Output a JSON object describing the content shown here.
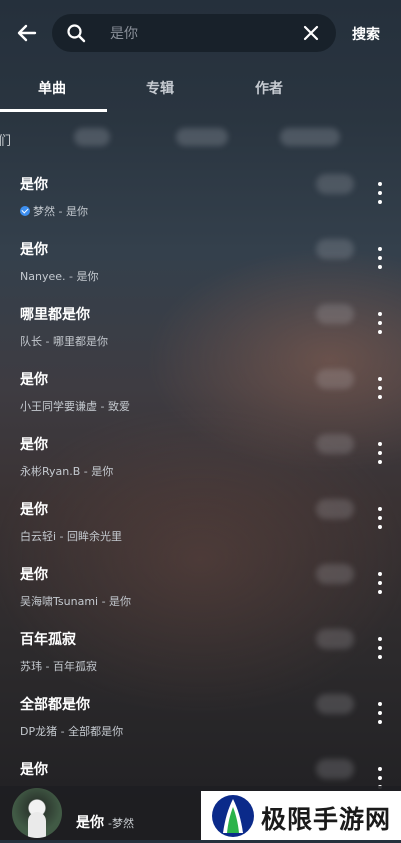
{
  "header": {
    "search_placeholder": "是你",
    "search_button_label": "搜索"
  },
  "tabs": [
    {
      "label": "单曲",
      "active": true
    },
    {
      "label": "专辑",
      "active": false
    },
    {
      "label": "作者",
      "active": false
    }
  ],
  "filter_fragment": "们",
  "songs": [
    {
      "title": "是你",
      "subtitle": "梦然 - 是你",
      "verified": true
    },
    {
      "title": "是你",
      "subtitle": "Nanyee. - 是你"
    },
    {
      "title": "哪里都是你",
      "subtitle": "队长 - 哪里都是你"
    },
    {
      "title": "是你",
      "subtitle": "小王同学要谦虚 - 致爱"
    },
    {
      "title": "是你",
      "subtitle": "永彬Ryan.B - 是你"
    },
    {
      "title": "是你",
      "subtitle": "白云轻i - 回眸余光里"
    },
    {
      "title": "是你",
      "subtitle": "吴海啸Tsunami - 是你"
    },
    {
      "title": "百年孤寂",
      "subtitle": "苏玮 - 百年孤寂"
    },
    {
      "title": "全部都是你",
      "subtitle": "DP龙猪 - 全部都是你"
    },
    {
      "title": "是你",
      "subtitle": ""
    }
  ],
  "player": {
    "title": "是你",
    "artist": "-梦然"
  },
  "watermark": {
    "text": "极限手游网",
    "logo_colors": [
      "#0b2a8a",
      "#2bb34a"
    ]
  },
  "icons": [
    "back-arrow-icon",
    "search-icon",
    "clear-icon",
    "more-vertical-icon",
    "verified-icon"
  ]
}
